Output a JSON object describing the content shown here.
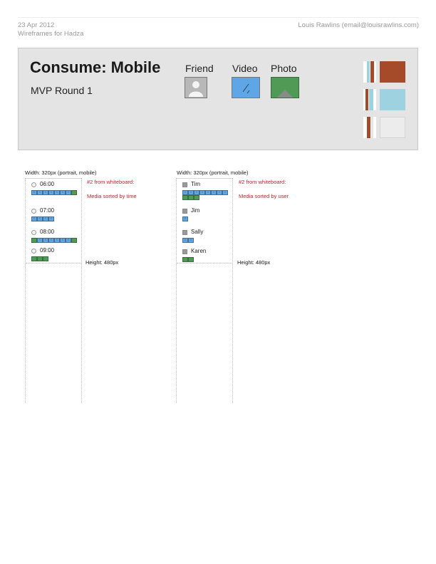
{
  "header": {
    "date": "23 Apr 2012",
    "project": "Wireframes for Hadza",
    "author": "Louis Rawlins (email@louisrawlins.com)"
  },
  "panel": {
    "title": "Consume: Mobile",
    "subtitle": "MVP Round 1",
    "legend": [
      {
        "label": "Friend",
        "icon": "user-silhouette-icon",
        "color": "#b8b8b8"
      },
      {
        "label": "Video",
        "icon": "video-icon",
        "color": "#5ea6e6"
      },
      {
        "label": "Photo",
        "icon": "photo-icon",
        "color": "#4f9a55"
      }
    ],
    "swatches": [
      "#a64b2a",
      "#9ed2e0",
      "#ececec"
    ]
  },
  "screens": [
    {
      "width_label": "Width: 320px (portrait, mobile)",
      "note_title": "#2 from whiteboard:",
      "note_body": "Media sorted by time",
      "height_label": "Height: 480px",
      "icon": "clock",
      "rows": [
        {
          "label": "06:00",
          "tiles": "vvvvvvvp"
        },
        {
          "label": "07:00",
          "tiles": "vvvv"
        },
        {
          "label": "08:00",
          "tiles": "pvvvvvvp"
        },
        {
          "label": "09:00",
          "tiles": "ppp"
        }
      ]
    },
    {
      "width_label": "Width: 320px (portrait, mobile)",
      "note_title": "#2 from whiteboard:",
      "note_body": "Media sorted by user",
      "height_label": "Height: 480px",
      "icon": "user",
      "rows": [
        {
          "label": "Tim",
          "tiles": "vvvvvvvvppp"
        },
        {
          "label": "Jim",
          "tiles": "v"
        },
        {
          "label": "Sally",
          "tiles": "vv"
        },
        {
          "label": "Karen",
          "tiles": "pp"
        }
      ]
    }
  ],
  "colors": {
    "video": "#5ea6e6",
    "photo": "#4f9a55",
    "accent_red": "#c1272d"
  }
}
